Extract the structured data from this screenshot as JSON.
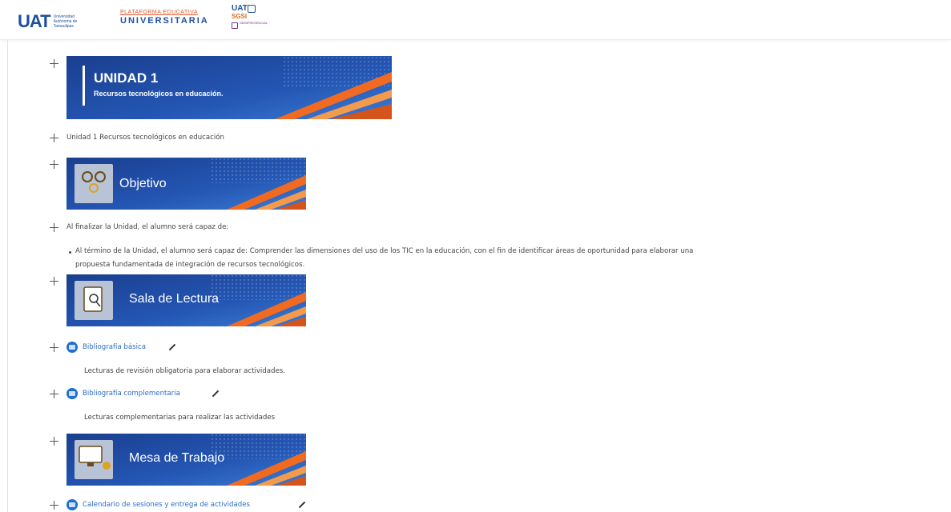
{
  "header": {
    "uat_logo": {
      "mark": "UAT",
      "subtitle": "Universidad Autónoma de Tamaulipas"
    },
    "plataforma_logo": {
      "line1": "PLATAFORMA EDUCATIVA",
      "line2": "UNIVERSITARIA"
    },
    "sgsi_logo": {
      "line1": "UAT",
      "line2": "SGSI",
      "line3": "SEMIPRESENCIAL"
    }
  },
  "banners": {
    "unidad": {
      "title": "UNIDAD 1",
      "subtitle": "Recursos tecnológicos en educación."
    },
    "objetivo": {
      "title": "Objetivo",
      "icon": "gears-icon"
    },
    "sala": {
      "title": "Sala de Lectura",
      "icon": "book-search-icon"
    },
    "mesa": {
      "title": "Mesa de Trabajo",
      "icon": "computer-user-icon"
    }
  },
  "colors": {
    "blue_dark": "#1a3f8f",
    "blue_mid": "#2456b4",
    "orange": "#f06a22",
    "link": "#2b6cc4"
  },
  "items": {
    "unit_label": "Unidad 1 Recursos tecnológicos en educación",
    "objective_intro": "Al finalizar la Unidad, el alumno será capaz de:",
    "objective_line1": "Al término de la Unidad, el alumno será capaz de: Comprender las dimensiones del uso de los TIC en la educación, con el fin de identificar áreas de oportunidad para elaborar una",
    "objective_line2": "propuesta fundamentada de integración de recursos tecnológicos.",
    "bib_basica": "Bibliografía básica",
    "bib_basica_desc": "Lecturas de revisión obligatoria para elaborar actividades.",
    "bib_comp": "Bibliografía complementaria",
    "bib_comp_desc": "Lecturas complementarias para realizar las actividades",
    "calendario": "Calendario de sesiones y entrega de actividades"
  }
}
